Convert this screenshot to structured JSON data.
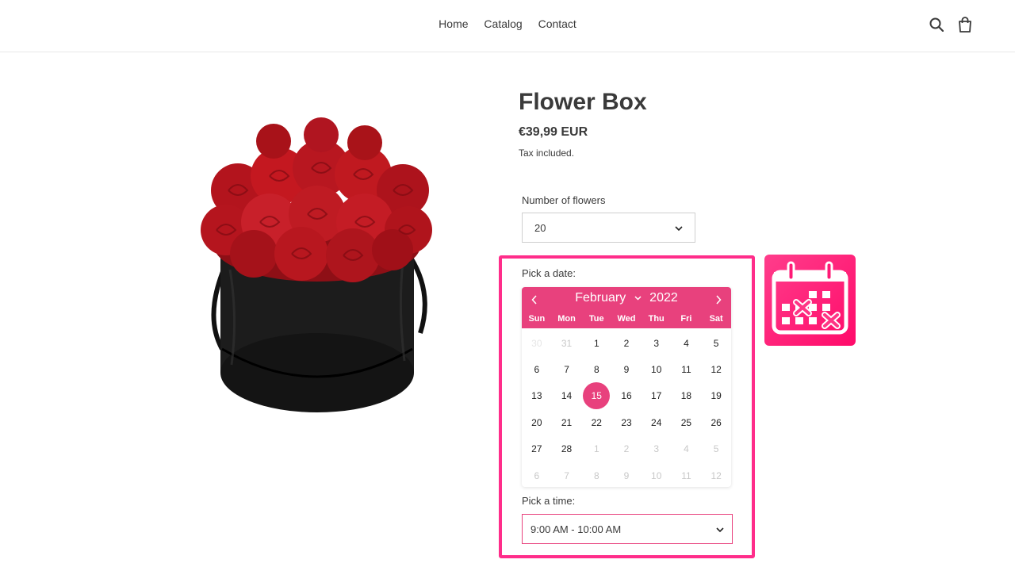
{
  "nav": {
    "items": [
      "Home",
      "Catalog",
      "Contact"
    ]
  },
  "header_icons": [
    "search-icon",
    "cart-icon"
  ],
  "product": {
    "title": "Flower Box",
    "price": "€39,99 EUR",
    "tax_note": "Tax included.",
    "image": "red-roses-in-black-hat-box"
  },
  "options": {
    "flowers_label": "Number of flowers",
    "flowers_value": "20"
  },
  "datepicker": {
    "label": "Pick a date:",
    "month": "February",
    "year": "2022",
    "weekdays": [
      "Sun",
      "Mon",
      "Tue",
      "Wed",
      "Thu",
      "Fri",
      "Sat"
    ],
    "selected_day": "15",
    "weeks": [
      [
        {
          "d": "30",
          "s": "faint"
        },
        {
          "d": "31",
          "s": "muted"
        },
        {
          "d": "1",
          "s": ""
        },
        {
          "d": "2",
          "s": ""
        },
        {
          "d": "3",
          "s": ""
        },
        {
          "d": "4",
          "s": ""
        },
        {
          "d": "5",
          "s": ""
        }
      ],
      [
        {
          "d": "6",
          "s": ""
        },
        {
          "d": "7",
          "s": ""
        },
        {
          "d": "8",
          "s": ""
        },
        {
          "d": "9",
          "s": ""
        },
        {
          "d": "10",
          "s": ""
        },
        {
          "d": "11",
          "s": ""
        },
        {
          "d": "12",
          "s": ""
        }
      ],
      [
        {
          "d": "13",
          "s": ""
        },
        {
          "d": "14",
          "s": ""
        },
        {
          "d": "15",
          "s": "selected"
        },
        {
          "d": "16",
          "s": ""
        },
        {
          "d": "17",
          "s": ""
        },
        {
          "d": "18",
          "s": ""
        },
        {
          "d": "19",
          "s": ""
        }
      ],
      [
        {
          "d": "20",
          "s": ""
        },
        {
          "d": "21",
          "s": ""
        },
        {
          "d": "22",
          "s": ""
        },
        {
          "d": "23",
          "s": ""
        },
        {
          "d": "24",
          "s": ""
        },
        {
          "d": "25",
          "s": ""
        },
        {
          "d": "26",
          "s": ""
        }
      ],
      [
        {
          "d": "27",
          "s": ""
        },
        {
          "d": "28",
          "s": ""
        },
        {
          "d": "1",
          "s": "muted"
        },
        {
          "d": "2",
          "s": "muted"
        },
        {
          "d": "3",
          "s": "muted"
        },
        {
          "d": "4",
          "s": "muted"
        },
        {
          "d": "5",
          "s": "muted"
        }
      ],
      [
        {
          "d": "6",
          "s": "muted"
        },
        {
          "d": "7",
          "s": "muted"
        },
        {
          "d": "8",
          "s": "muted"
        },
        {
          "d": "9",
          "s": "muted"
        },
        {
          "d": "10",
          "s": "muted"
        },
        {
          "d": "11",
          "s": "muted"
        },
        {
          "d": "12",
          "s": "muted"
        }
      ]
    ]
  },
  "timepicker": {
    "label": "Pick a time:",
    "value": "9:00 AM - 10:00 AM"
  },
  "colors": {
    "accent": "#e8417d",
    "highlight": "#ff2d8a",
    "text": "#3a3a3a"
  },
  "app_icon": "calendar-unavailable-icon"
}
